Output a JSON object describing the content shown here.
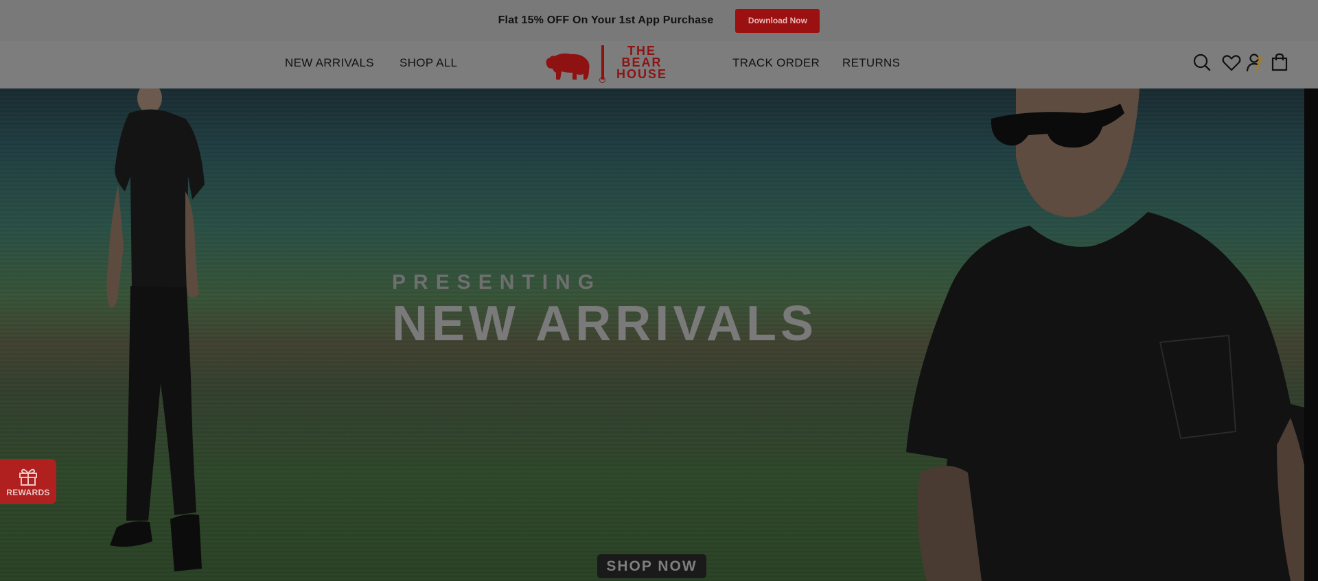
{
  "announcement": {
    "text": "Flat 15% OFF On Your 1st App Purchase",
    "button_label": "Download Now"
  },
  "nav": {
    "left_links": [
      "NEW ARRIVALS",
      "SHOP ALL"
    ],
    "right_links": [
      "TRACK ORDER",
      "RETURNS"
    ],
    "logo_lines": [
      "THE",
      "BEAR",
      "HOUSE"
    ],
    "icons": [
      "search-icon",
      "wishlist-heart-icon",
      "account-icon",
      "cart-bag-icon"
    ]
  },
  "hero": {
    "kicker": "PRESENTING",
    "headline": "NEW ARRIVALS",
    "cta_label": "SHOP NOW"
  },
  "rewards": {
    "label": "REWARDS"
  },
  "colors": {
    "brand_red": "#9b1010",
    "overlay_gray": "#7d7d7d"
  }
}
